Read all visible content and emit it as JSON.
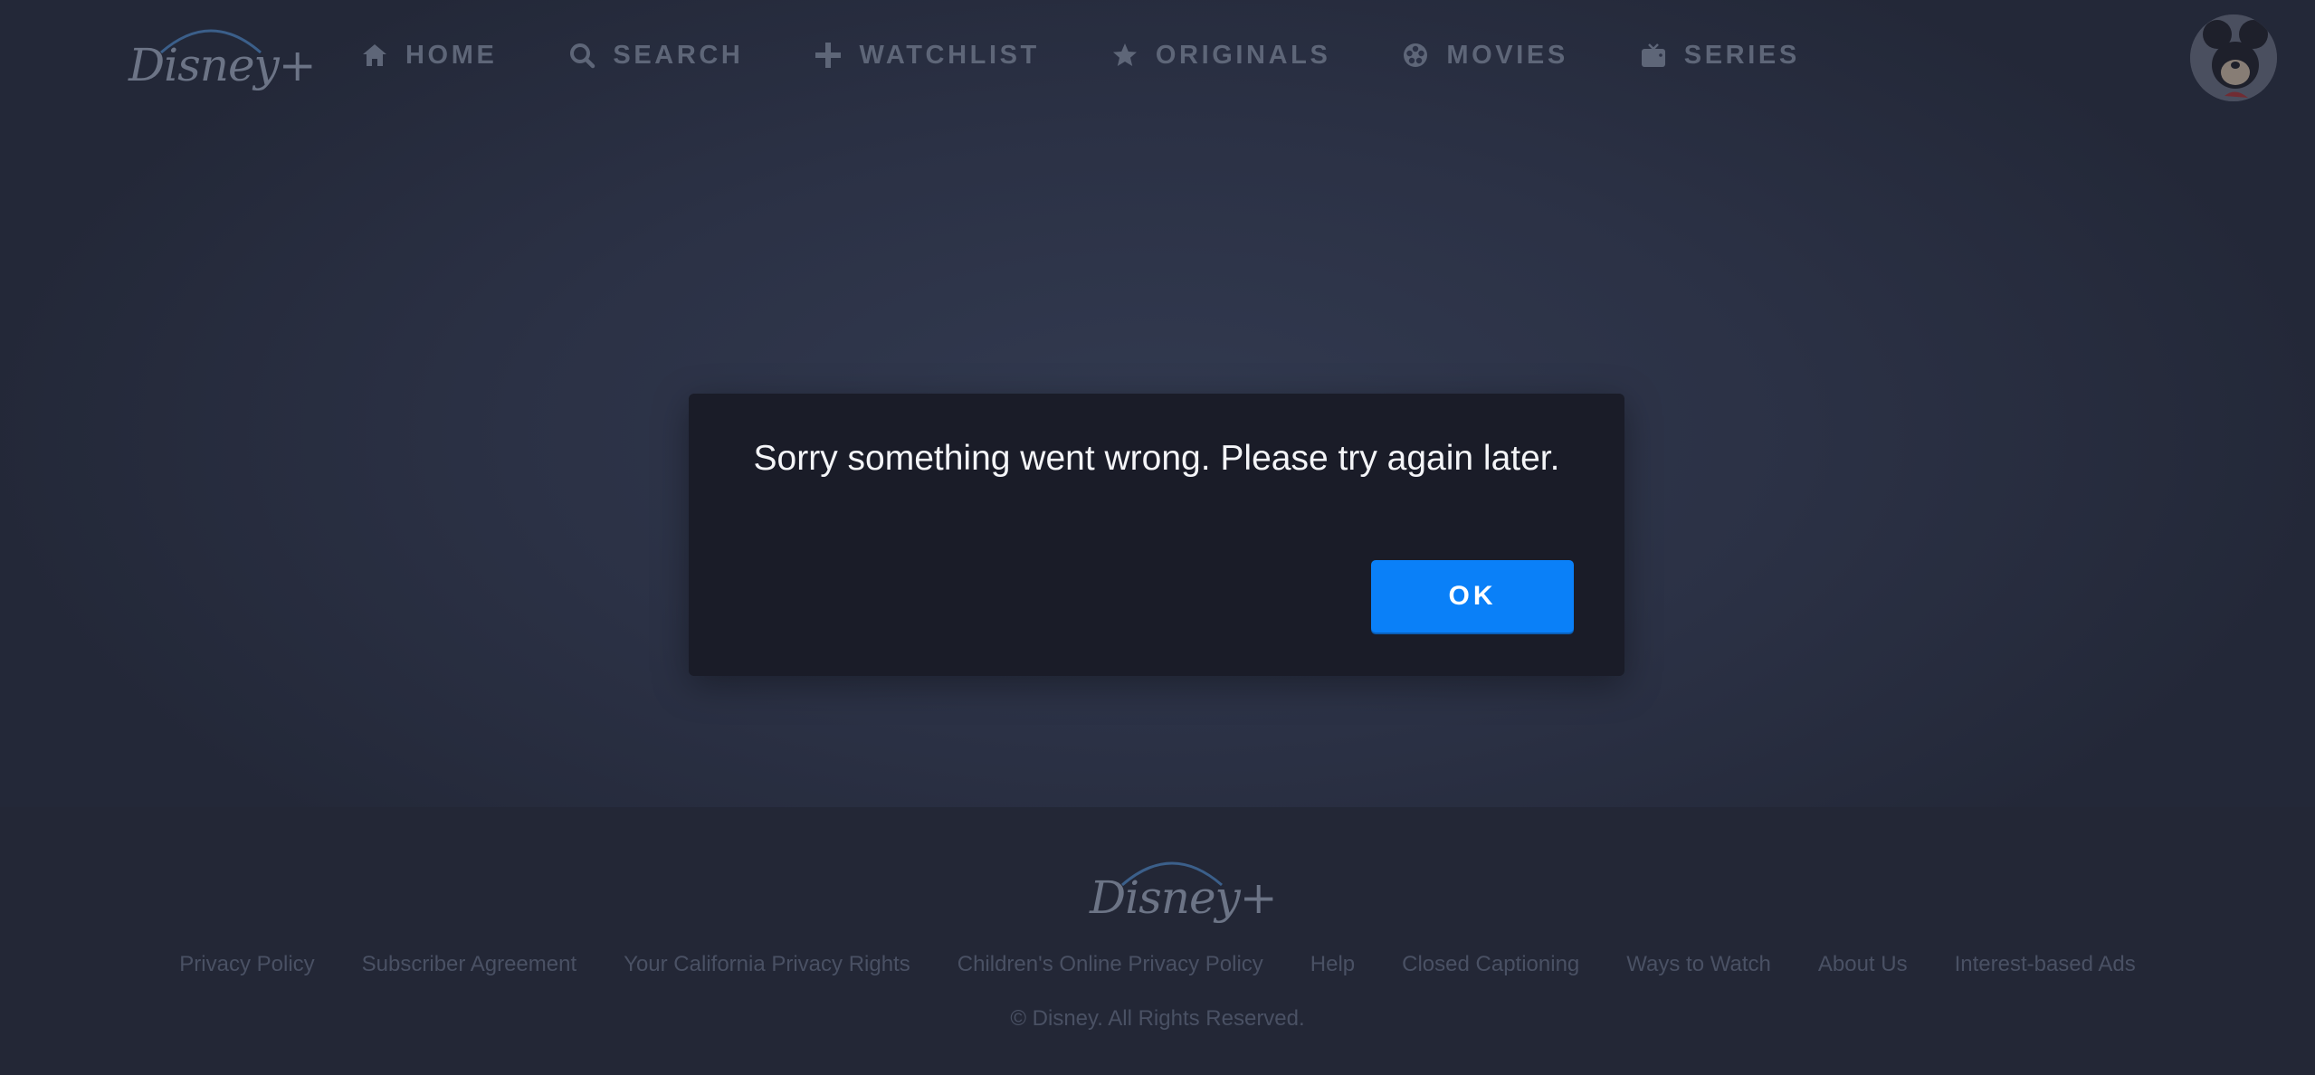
{
  "header": {
    "logo_text": "Disney+",
    "nav": [
      {
        "label": "HOME",
        "icon": "home-icon"
      },
      {
        "label": "SEARCH",
        "icon": "search-icon"
      },
      {
        "label": "WATCHLIST",
        "icon": "plus-icon"
      },
      {
        "label": "ORIGINALS",
        "icon": "star-icon"
      },
      {
        "label": "MOVIES",
        "icon": "film-reel-icon"
      },
      {
        "label": "SERIES",
        "icon": "tv-icon"
      }
    ],
    "avatar_icon": "mickey-avatar-icon"
  },
  "modal": {
    "message": "Sorry something went wrong. Please try again later.",
    "ok_label": "OK"
  },
  "footer": {
    "logo_text": "Disney+",
    "links": [
      "Privacy Policy",
      "Subscriber Agreement",
      "Your California Privacy Rights",
      "Children's Online Privacy Policy",
      "Help",
      "Closed Captioning",
      "Ways to Watch",
      "About Us",
      "Interest-based Ads"
    ],
    "copyright": "© Disney. All Rights Reserved."
  },
  "colors": {
    "background": "#2b3145",
    "modal_background": "#1a1c28",
    "accent_button": "#0a80f8",
    "nav_text": "#5e6678",
    "footer_text": "#4a5164"
  }
}
